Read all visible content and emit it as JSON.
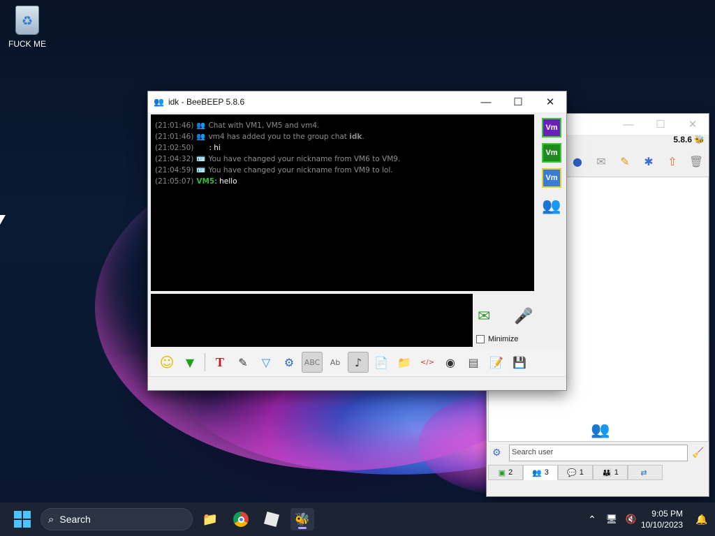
{
  "desktop": {
    "icons": [
      {
        "label": "FUCK ME",
        "icon": "recycle-bin-icon"
      }
    ]
  },
  "chat_window": {
    "title": "idk - BeeBEEP 5.8.6",
    "log": [
      {
        "time": "(21:01:46)",
        "text": "Chat with VM1, VM5 and vm4.",
        "type": "system",
        "icon": "group-icon"
      },
      {
        "time": "(21:01:46)",
        "text_before": "vm4 has added you to the group chat ",
        "bold": "idk",
        "text_after": ".",
        "type": "system",
        "icon": "group-add-icon"
      },
      {
        "time": "(21:02:50)",
        "text": ": hi",
        "type": "message",
        "nick": ""
      },
      {
        "time": "(21:04:32)",
        "text": "You have changed your nickname from VM6 to VM9.",
        "type": "system",
        "icon": "id-card-icon"
      },
      {
        "time": "(21:04:59)",
        "text": "You have changed your nickname from VM9 to lol.",
        "type": "system",
        "icon": "id-card-icon"
      },
      {
        "time": "(21:05:07)",
        "nick": "VM5",
        "text": ": hello",
        "type": "message"
      }
    ],
    "members": [
      {
        "label": "Vm",
        "color": "#6a1fb8",
        "border": "#33cc33"
      },
      {
        "label": "Vm",
        "color": "#1f8a1f",
        "border": "#33cc33"
      },
      {
        "label": "Vm",
        "color": "#3a7bd5",
        "border": "#e5d21f"
      }
    ],
    "minimize_label": "Minimize",
    "minimize_checked": false
  },
  "main_window": {
    "version": "5.8.6",
    "search_placeholder": "Search user",
    "tabs": [
      {
        "icon": "chat-green-icon",
        "count": "2"
      },
      {
        "icon": "users-icon",
        "count": "3"
      },
      {
        "icon": "messages-icon",
        "count": "1"
      },
      {
        "icon": "group-icon",
        "count": "1"
      },
      {
        "icon": "share-icon",
        "count": ""
      }
    ]
  },
  "taskbar": {
    "search_label": "Search",
    "time": "9:05 PM",
    "date": "10/10/2023"
  }
}
